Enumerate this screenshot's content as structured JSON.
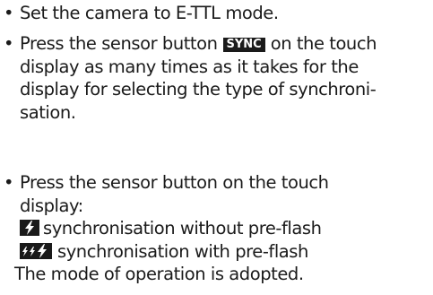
{
  "items": [
    {
      "bullet": "•",
      "text": "Set the camera to E-TTL mode."
    },
    {
      "bullet": "•",
      "line1_before": "Press the sensor button",
      "badge": "SYNC",
      "line1_after": "on the touch",
      "line2": "display as many times as it takes for the",
      "line3": "display for selecting the type of synchroni-",
      "line4": "sation."
    },
    {
      "bullet": "•",
      "line1": "Press the sensor button on the touch",
      "line2": "display:",
      "option1_icon": "flash-single-icon",
      "option1_text": "synchronisation without pre-flash",
      "option2_icon": "flash-preflash-icon",
      "option2_text": "synchronisation with pre-flash",
      "conclusion": "The mode of operation is adopted."
    }
  ]
}
